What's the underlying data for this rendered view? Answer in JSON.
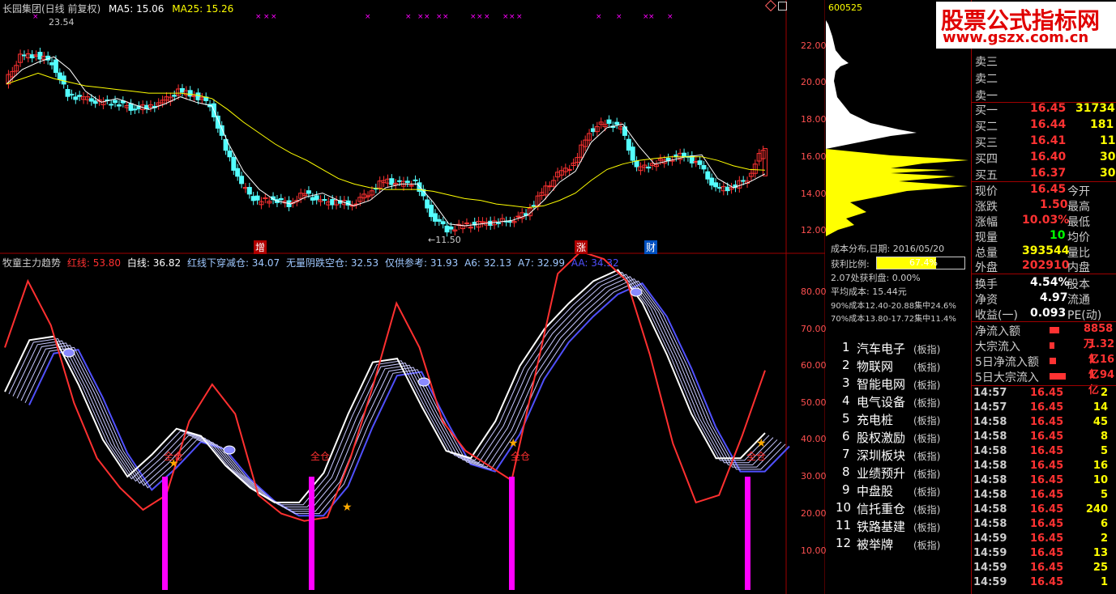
{
  "upper": {
    "title": "长园集团(日线 前复权)",
    "ma5_label": "MA5: 15.06",
    "ma25_label": "MA25: 15.26",
    "hi_label": "23.54",
    "lo_label": "←11.50",
    "price_ticks": [
      "22.00",
      "20.00",
      "18.00",
      "16.00",
      "14.00",
      "12.00"
    ],
    "markers": [
      "增",
      "涨",
      "财"
    ]
  },
  "lower": {
    "title": "牧童主力趋势",
    "red_label": "红线: 53.80",
    "white_label": "白线: 36.82",
    "cross_label": "红线下穿减仓: 34.07",
    "nocap_label": "无量阴跌空仓: 32.53",
    "ref_label": "仅供参考: 31.93",
    "a6_label": "A6: 32.13",
    "a7_label": "A7: 32.99",
    "aa_label": "AA: 34.32",
    "ticks": [
      "80.00",
      "70.00",
      "60.00",
      "50.00",
      "40.00",
      "30.00",
      "20.00",
      "10.00"
    ],
    "signal_text": "全仓"
  },
  "chart_data": [
    {
      "type": "line",
      "title": "长园集团(日线 前复权)",
      "ylim": [
        11,
        24
      ],
      "series": [
        {
          "name": "MA5",
          "values": [
            20.0,
            20.8,
            21.2,
            21.5,
            20.8,
            19.6,
            19.0,
            19.2,
            18.9,
            18.6,
            18.9,
            19.3,
            19.0,
            18.8,
            16.8,
            15.2,
            14.2,
            13.6,
            13.4,
            13.8,
            14.0,
            13.6,
            13.3,
            13.6,
            14.3,
            14.5,
            14.5,
            13.5,
            12.3,
            12.2,
            12.3,
            12.4,
            12.5,
            12.8,
            13.6,
            14.6,
            15.2,
            16.8,
            17.6,
            17.8,
            16.6,
            15.6,
            15.8,
            16.0,
            16.1,
            14.8,
            14.3,
            14.6,
            15.06
          ]
        },
        {
          "name": "MA25",
          "values": [
            20.0,
            20.3,
            20.6,
            20.3,
            20.1,
            19.9,
            19.8,
            19.7,
            19.6,
            19.5,
            19.5,
            19.5,
            19.4,
            19.2,
            18.6,
            17.9,
            17.3,
            16.7,
            16.2,
            15.8,
            15.3,
            14.8,
            14.5,
            14.3,
            14.2,
            14.2,
            14.2,
            14.1,
            13.9,
            13.7,
            13.6,
            13.4,
            13.3,
            13.2,
            13.3,
            13.6,
            14.0,
            14.7,
            15.3,
            15.6,
            15.8,
            15.9,
            16.0,
            16.0,
            16.0,
            15.8,
            15.5,
            15.3,
            15.26
          ]
        },
        {
          "name": "Close",
          "values": [
            20.0,
            21.5,
            21.6,
            21.2,
            19.4,
            19.2,
            19.0,
            19.0,
            18.7,
            18.7,
            19.0,
            19.6,
            19.4,
            18.9,
            16.4,
            14.4,
            13.5,
            13.7,
            13.4,
            14.0,
            13.5,
            13.5,
            13.4,
            14.0,
            14.7,
            14.5,
            14.6,
            12.8,
            12.0,
            12.2,
            12.3,
            12.4,
            12.5,
            12.9,
            14.0,
            15.0,
            15.6,
            17.4,
            17.9,
            17.6,
            15.3,
            15.6,
            15.9,
            16.1,
            15.5,
            14.2,
            14.3,
            14.8,
            16.45
          ]
        }
      ]
    },
    {
      "type": "line",
      "title": "牧童主力趋势",
      "ylim": [
        0,
        85
      ],
      "series": [
        {
          "name": "红线",
          "values": [
            60,
            78,
            66,
            45,
            30,
            22,
            16,
            20,
            40,
            50,
            42,
            20,
            15,
            13,
            14,
            30,
            50,
            72,
            60,
            40,
            32,
            28,
            24,
            52,
            80,
            86,
            84,
            78,
            58,
            34,
            18,
            20,
            36,
            53.8
          ]
        },
        {
          "name": "白线",
          "values": [
            48,
            62,
            63,
            50,
            35,
            25,
            31,
            38,
            36,
            28,
            22,
            18,
            18,
            26,
            42,
            56,
            57,
            44,
            32,
            30,
            40,
            55,
            65,
            72,
            78,
            81,
            72,
            58,
            42,
            30,
            30,
            36.82
          ]
        }
      ]
    }
  ],
  "right_panel": {
    "stock_code": "600525",
    "site_logo": "股票公式指标网",
    "site_url": "www.gszx.com.cn",
    "cost_date": "成本分布,日期: 2016/05/20",
    "profit_label": "获利比例:",
    "profit_value": "67.4%",
    "profit_at": "2.07处获利盘: 0.00%",
    "avg_cost": "平均成本: 15.44元",
    "cost90": "90%成本12.40-20.88集中24.6%",
    "cost70": "70%成本13.80-17.72集中11.4%",
    "sectors": [
      {
        "no": "1",
        "name": "汽车电子",
        "tag": "(板指)"
      },
      {
        "no": "2",
        "name": "物联网",
        "tag": "(板指)"
      },
      {
        "no": "3",
        "name": "智能电网",
        "tag": "(板指)"
      },
      {
        "no": "4",
        "name": "电气设备",
        "tag": "(板指)"
      },
      {
        "no": "5",
        "name": "充电桩",
        "tag": "(板指)"
      },
      {
        "no": "6",
        "name": "股权激励",
        "tag": "(板指)"
      },
      {
        "no": "7",
        "name": "深圳板块",
        "tag": "(板指)"
      },
      {
        "no": "8",
        "name": "业绩预升",
        "tag": "(板指)"
      },
      {
        "no": "9",
        "name": "中盘股",
        "tag": "(板指)"
      },
      {
        "no": "10",
        "name": "信托重仓",
        "tag": "(板指)"
      },
      {
        "no": "11",
        "name": "铁路基建",
        "tag": "(板指)"
      },
      {
        "no": "12",
        "name": "被举牌",
        "tag": "(板指)"
      }
    ]
  },
  "quote_panel": {
    "sell": [
      {
        "label": "卖三"
      },
      {
        "label": "卖二"
      },
      {
        "label": "卖一"
      }
    ],
    "buy": [
      {
        "label": "买一",
        "price": "16.45",
        "vol": "31734"
      },
      {
        "label": "买二",
        "price": "16.44",
        "vol": "181"
      },
      {
        "label": "买三",
        "price": "16.41",
        "vol": "11"
      },
      {
        "label": "买四",
        "price": "16.40",
        "vol": "30"
      },
      {
        "label": "买五",
        "price": "16.37",
        "vol": "30"
      }
    ],
    "stats": [
      {
        "label": "现价",
        "value": "16.45",
        "label2": "今开"
      },
      {
        "label": "涨跌",
        "value": "1.50",
        "label2": "最高"
      },
      {
        "label": "涨幅",
        "value": "10.03%",
        "label2": "最低"
      },
      {
        "label": "现量",
        "value": "10",
        "label2": "均价"
      },
      {
        "label": "总量",
        "value": "393544",
        "label2": "量比"
      },
      {
        "label": "外盘",
        "value": "202910",
        "label2": "内盘"
      }
    ],
    "stats2": [
      {
        "label": "换手",
        "value": "4.54%",
        "label2": "股本"
      },
      {
        "label": "净资",
        "value": "4.97",
        "label2": "流通"
      },
      {
        "label": "收益(一)",
        "value": "0.093",
        "label2": "PE(动)"
      }
    ],
    "flows": [
      {
        "label": "净流入额",
        "value": "8858万"
      },
      {
        "label": "大宗流入",
        "value": "1.32亿"
      },
      {
        "label": "5日净流入额",
        "value": "1.16亿"
      },
      {
        "label": "5日大宗流入",
        "value": "1.94亿"
      }
    ],
    "ticks": [
      {
        "t": "14:57",
        "p": "16.45",
        "v": "2"
      },
      {
        "t": "14:57",
        "p": "16.45",
        "v": "14"
      },
      {
        "t": "14:58",
        "p": "16.45",
        "v": "45"
      },
      {
        "t": "14:58",
        "p": "16.45",
        "v": "8"
      },
      {
        "t": "14:58",
        "p": "16.45",
        "v": "5"
      },
      {
        "t": "14:58",
        "p": "16.45",
        "v": "16"
      },
      {
        "t": "14:58",
        "p": "16.45",
        "v": "10"
      },
      {
        "t": "14:58",
        "p": "16.45",
        "v": "5"
      },
      {
        "t": "14:58",
        "p": "16.45",
        "v": "240"
      },
      {
        "t": "14:58",
        "p": "16.45",
        "v": "6"
      },
      {
        "t": "14:59",
        "p": "16.45",
        "v": "2"
      },
      {
        "t": "14:59",
        "p": "16.45",
        "v": "13"
      },
      {
        "t": "14:59",
        "p": "16.45",
        "v": "25"
      },
      {
        "t": "14:59",
        "p": "16.45",
        "v": "1"
      }
    ]
  },
  "colors": {
    "red": "#ff3030",
    "yellow": "#ffff00",
    "magenta": "#ff00ff",
    "up": "#ff3232",
    "down": "#54ffff",
    "purple_line": "#5050ff",
    "grid_red": "#a00000"
  }
}
